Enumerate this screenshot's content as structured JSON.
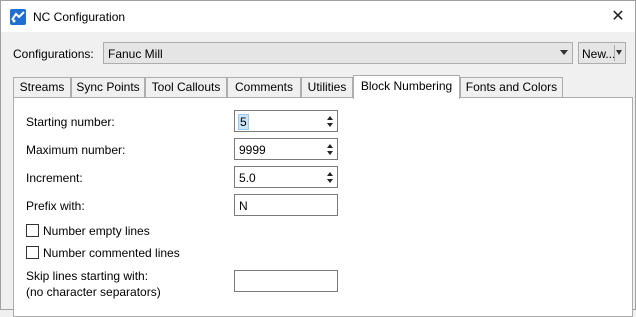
{
  "window": {
    "title": "NC Configuration"
  },
  "config": {
    "label": "Configurations:",
    "selected": "Fanuc Mill",
    "new_label": "New..."
  },
  "tabs": [
    {
      "label": "Streams"
    },
    {
      "label": "Sync Points"
    },
    {
      "label": "Tool Callouts"
    },
    {
      "label": "Comments"
    },
    {
      "label": "Utilities"
    },
    {
      "label": "Block Numbering",
      "active": true
    },
    {
      "label": "Fonts and Colors"
    }
  ],
  "block_numbering": {
    "starting_number": {
      "label": "Starting number:",
      "value": "5"
    },
    "maximum_number": {
      "label": "Maximum number:",
      "value": "9999"
    },
    "increment": {
      "label": "Increment:",
      "value": "5.0"
    },
    "prefix": {
      "label": "Prefix with:",
      "value": "N"
    },
    "number_empty_lines": {
      "label": "Number empty lines",
      "checked": false
    },
    "number_commented_lines": {
      "label": "Number commented lines",
      "checked": false
    },
    "skip_lines": {
      "label_line1": "Skip lines starting with:",
      "label_line2": "(no character separators)",
      "value": ""
    }
  },
  "icons": {
    "app": "nc-app-icon",
    "close": "close-icon",
    "dropdown": "chevron-down-icon",
    "spin_up": "spin-up-icon",
    "spin_down": "spin-down-icon"
  }
}
